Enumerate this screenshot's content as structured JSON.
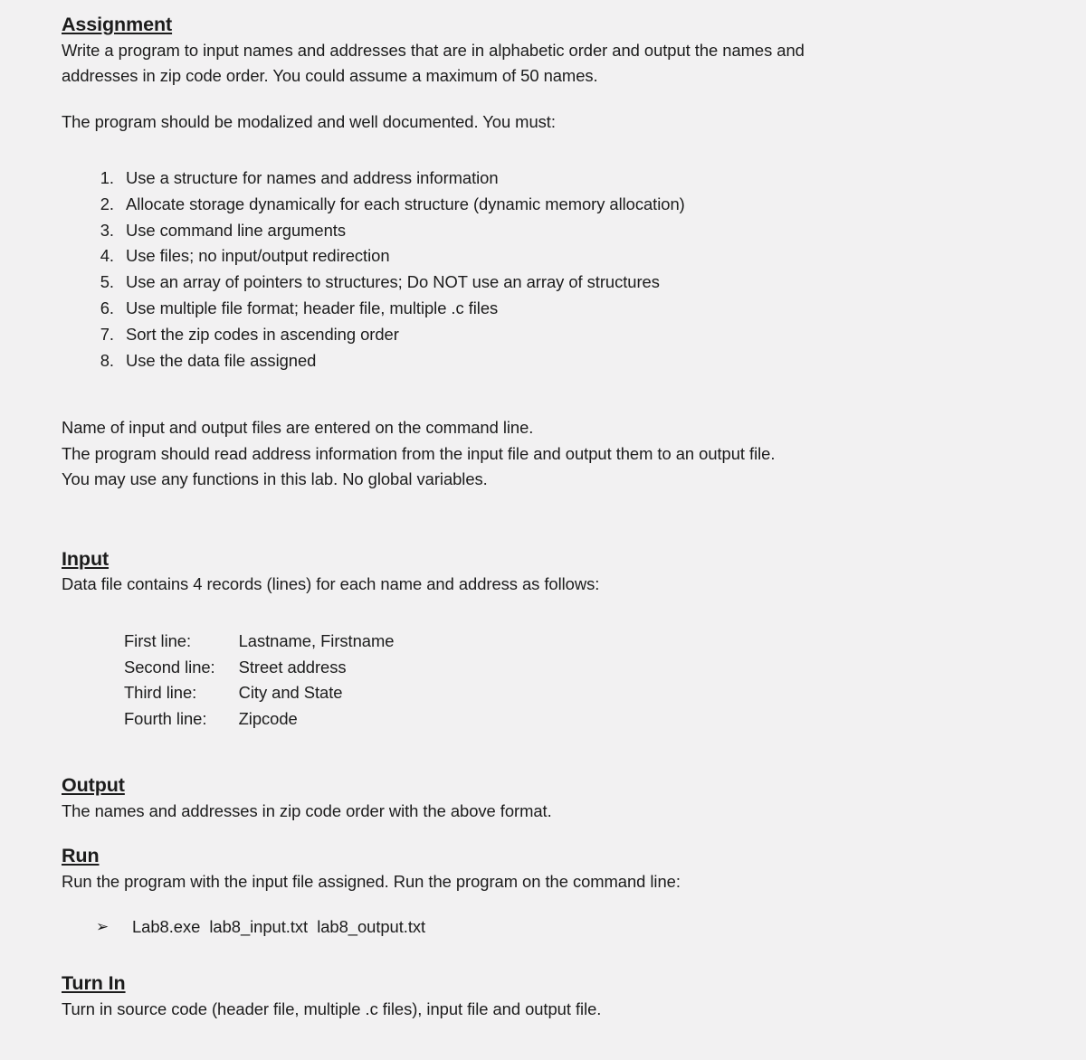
{
  "document": {
    "background_color": "#f2f1f2",
    "text_color": "#1c1c1c"
  },
  "assignment": {
    "heading": "Assignment",
    "intro_line1": "Write a program to input names and addresses that are in alphabetic order and output the names and",
    "intro_line2": "addresses in zip code order. You could assume a maximum of 50 names.",
    "must_line": "The program should be modalized and well documented. You must:",
    "requirements": [
      {
        "num": "1.",
        "text": "Use a structure for names and address information"
      },
      {
        "num": "2.",
        "text": "Allocate storage dynamically for each structure (dynamic memory allocation)"
      },
      {
        "num": "3.",
        "text": "Use command line arguments"
      },
      {
        "num": "4.",
        "text": "Use files; no input/output redirection"
      },
      {
        "num": "5.",
        "text": "Use an array of pointers to structures; Do NOT use an array of structures"
      },
      {
        "num": "6.",
        "text": "Use multiple file format; header file, multiple .c files"
      },
      {
        "num": "7.",
        "text": "Sort the zip codes in ascending order"
      },
      {
        "num": "8.",
        "text": "Use the data file assigned"
      }
    ],
    "notes": [
      "Name of input and output files are entered on the command line.",
      "The program should read address information from the input file and output them to an output file.",
      "You may use any functions in this lab. No global variables."
    ]
  },
  "input_section": {
    "heading": "Input",
    "description": "Data file contains 4 records (lines) for each name and address as follows:",
    "records": [
      {
        "label": "First line:",
        "value": "Lastname, Firstname"
      },
      {
        "label": "Second line:",
        "value": "Street address"
      },
      {
        "label": "Third line:",
        "value": "City and State"
      },
      {
        "label": "Fourth line:",
        "value": "Zipcode"
      }
    ]
  },
  "output_section": {
    "heading": "Output",
    "description": "The names and addresses in zip code order with the above format."
  },
  "run_section": {
    "heading": "Run",
    "description": "Run the program with the input file assigned. Run the program on the command line:",
    "bullet_glyph": "➢",
    "command": "Lab8.exe  lab8_input.txt  lab8_output.txt"
  },
  "turnin_section": {
    "heading": "Turn In",
    "description": "Turn in source code (header file, multiple .c files), input file and output file."
  }
}
